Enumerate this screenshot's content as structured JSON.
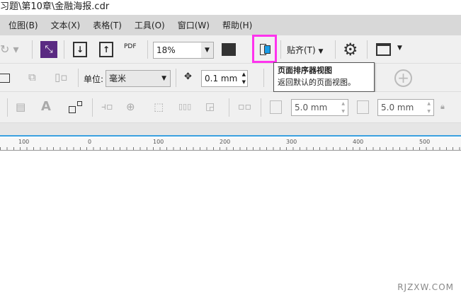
{
  "title": "习题\\第10章\\金融海报.cdr",
  "menu": [
    "位图(B)",
    "文本(X)",
    "表格(T)",
    "工具(O)",
    "窗口(W)",
    "帮助(H)"
  ],
  "toolbar1": {
    "pdf": "PDF",
    "zoom": "18%",
    "snap": "贴齐(T)"
  },
  "toolbar2": {
    "unit_label": "单位:",
    "unit_value": "毫米",
    "nudge": "0.1 mm"
  },
  "toolbar3": {
    "dup_x": "5.0 mm",
    "dup_y": "5.0 mm"
  },
  "tooltip": {
    "title": "页面排序器视图",
    "desc": "返回默认的页面视图。"
  },
  "ruler": [
    "100",
    "0",
    "100",
    "200",
    "300",
    "400",
    "500"
  ],
  "watermark": "RJZXW.COM",
  "colors": {
    "highlight": "#ff33ee",
    "accent": "#3aa0e0",
    "purple": "#5a2a82"
  }
}
